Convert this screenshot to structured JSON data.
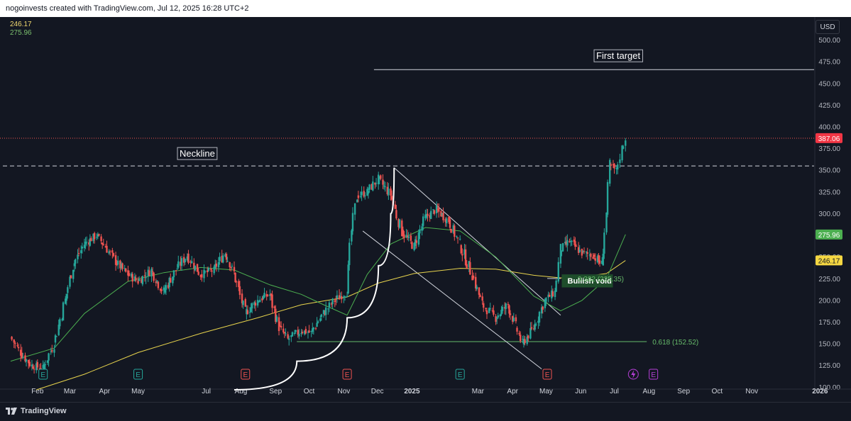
{
  "header": {
    "attribution": "nogoinvests created with TradingView.com, Jul 12, 2025 16:28 UTC+2"
  },
  "legend": {
    "ma_slow_value": "246.17",
    "ma_fast_value": "275.96"
  },
  "currency_button": "USD",
  "footer": {
    "brand": "TradingView"
  },
  "colors": {
    "background": "#131722",
    "up": "#26a69a",
    "down": "#ef5350",
    "ma_fast": "#4caf50",
    "ma_slow": "#e8d44d",
    "last_price": "#ef5350"
  },
  "annotations": {
    "neckline": "Neckline",
    "first_target": "First target",
    "bullish_void": "Bullish void",
    "fib_382": "0.382 (225.35)",
    "fib_618": "0.618 (152.52)"
  },
  "price_tags": {
    "last": "387.06",
    "ma_fast": "275.96",
    "ma_slow": "246.17"
  },
  "earnings_markers": [
    "E",
    "E",
    "E",
    "E",
    "E",
    "E",
    "E"
  ],
  "chart_data": {
    "type": "candlestick",
    "title": "",
    "y_axis": {
      "ticks": [
        100,
        125,
        150,
        175,
        200,
        225,
        250,
        275,
        300,
        325,
        350,
        375,
        400,
        425,
        450,
        475,
        500
      ],
      "range": [
        97,
        516
      ],
      "position": "right"
    },
    "x_axis": {
      "ticks": [
        "Feb",
        "Mar",
        "Apr",
        "May",
        "Jul",
        "Aug",
        "Sep",
        "Oct",
        "Nov",
        "Dec",
        "2025",
        "Mar",
        "Apr",
        "May",
        "Jun",
        "Jul",
        "Aug",
        "Sep",
        "Oct",
        "Nov",
        "2026"
      ],
      "bold": [
        "2025",
        "2026"
      ]
    },
    "closes": [
      {
        "d": "2024-01-08",
        "c": 158
      },
      {
        "d": "2024-01-17",
        "c": 140
      },
      {
        "d": "2024-01-27",
        "c": 125
      },
      {
        "d": "2024-02-06",
        "c": 122
      },
      {
        "d": "2024-02-16",
        "c": 150
      },
      {
        "d": "2024-02-26",
        "c": 200
      },
      {
        "d": "2024-03-04",
        "c": 240
      },
      {
        "d": "2024-03-14",
        "c": 265
      },
      {
        "d": "2024-03-25",
        "c": 275
      },
      {
        "d": "2024-04-02",
        "c": 262
      },
      {
        "d": "2024-04-11",
        "c": 245
      },
      {
        "d": "2024-04-22",
        "c": 230
      },
      {
        "d": "2024-05-01",
        "c": 222
      },
      {
        "d": "2024-05-13",
        "c": 235
      },
      {
        "d": "2024-05-24",
        "c": 210
      },
      {
        "d": "2024-06-04",
        "c": 235
      },
      {
        "d": "2024-06-14",
        "c": 252
      },
      {
        "d": "2024-06-26",
        "c": 230
      },
      {
        "d": "2024-07-08",
        "c": 235
      },
      {
        "d": "2024-07-18",
        "c": 255
      },
      {
        "d": "2024-07-26",
        "c": 232
      },
      {
        "d": "2024-08-05",
        "c": 185
      },
      {
        "d": "2024-08-16",
        "c": 200
      },
      {
        "d": "2024-08-27",
        "c": 207
      },
      {
        "d": "2024-09-04",
        "c": 170
      },
      {
        "d": "2024-09-12",
        "c": 155
      },
      {
        "d": "2024-09-24",
        "c": 165
      },
      {
        "d": "2024-10-03",
        "c": 163
      },
      {
        "d": "2024-10-14",
        "c": 185
      },
      {
        "d": "2024-10-24",
        "c": 200
      },
      {
        "d": "2024-11-04",
        "c": 210
      },
      {
        "d": "2024-11-08",
        "c": 280
      },
      {
        "d": "2024-11-13",
        "c": 320
      },
      {
        "d": "2024-11-22",
        "c": 325
      },
      {
        "d": "2024-12-02",
        "c": 340
      },
      {
        "d": "2024-12-13",
        "c": 322
      },
      {
        "d": "2024-12-23",
        "c": 280
      },
      {
        "d": "2025-01-03",
        "c": 262
      },
      {
        "d": "2025-01-13",
        "c": 295
      },
      {
        "d": "2025-01-23",
        "c": 305
      },
      {
        "d": "2025-02-03",
        "c": 292
      },
      {
        "d": "2025-02-13",
        "c": 265
      },
      {
        "d": "2025-02-24",
        "c": 230
      },
      {
        "d": "2025-03-05",
        "c": 195
      },
      {
        "d": "2025-03-17",
        "c": 180
      },
      {
        "d": "2025-03-28",
        "c": 195
      },
      {
        "d": "2025-04-04",
        "c": 170
      },
      {
        "d": "2025-04-10",
        "c": 150
      },
      {
        "d": "2025-04-20",
        "c": 168
      },
      {
        "d": "2025-04-30",
        "c": 200
      },
      {
        "d": "2025-05-09",
        "c": 210
      },
      {
        "d": "2025-05-14",
        "c": 258
      },
      {
        "d": "2025-05-22",
        "c": 268
      },
      {
        "d": "2025-06-02",
        "c": 255
      },
      {
        "d": "2025-06-12",
        "c": 252
      },
      {
        "d": "2025-06-20",
        "c": 242
      },
      {
        "d": "2025-06-24",
        "c": 300
      },
      {
        "d": "2025-06-27",
        "c": 355
      },
      {
        "d": "2025-07-03",
        "c": 350
      },
      {
        "d": "2025-07-08",
        "c": 375
      },
      {
        "d": "2025-07-11",
        "c": 387
      }
    ],
    "ma_fast_series": [
      {
        "d": "2024-01-08",
        "v": 130
      },
      {
        "d": "2024-02-16",
        "v": 145
      },
      {
        "d": "2024-03-14",
        "v": 185
      },
      {
        "d": "2024-04-22",
        "v": 222
      },
      {
        "d": "2024-05-24",
        "v": 232
      },
      {
        "d": "2024-06-26",
        "v": 238
      },
      {
        "d": "2024-07-26",
        "v": 235
      },
      {
        "d": "2024-08-27",
        "v": 218
      },
      {
        "d": "2024-09-24",
        "v": 207
      },
      {
        "d": "2024-10-14",
        "v": 195
      },
      {
        "d": "2024-11-04",
        "v": 183
      },
      {
        "d": "2024-11-22",
        "v": 230
      },
      {
        "d": "2024-12-13",
        "v": 265
      },
      {
        "d": "2025-01-13",
        "v": 284
      },
      {
        "d": "2025-02-13",
        "v": 280
      },
      {
        "d": "2025-03-17",
        "v": 250
      },
      {
        "d": "2025-04-20",
        "v": 205
      },
      {
        "d": "2025-05-14",
        "v": 188
      },
      {
        "d": "2025-06-02",
        "v": 200
      },
      {
        "d": "2025-06-24",
        "v": 225
      },
      {
        "d": "2025-07-11",
        "v": 276
      }
    ],
    "ma_slow_series": [
      {
        "d": "2024-01-31",
        "v": 97
      },
      {
        "d": "2024-03-14",
        "v": 115
      },
      {
        "d": "2024-05-01",
        "v": 140
      },
      {
        "d": "2024-06-26",
        "v": 162
      },
      {
        "d": "2024-08-16",
        "v": 180
      },
      {
        "d": "2024-09-24",
        "v": 195
      },
      {
        "d": "2024-11-04",
        "v": 204
      },
      {
        "d": "2024-12-02",
        "v": 220
      },
      {
        "d": "2025-01-03",
        "v": 231
      },
      {
        "d": "2025-02-13",
        "v": 237
      },
      {
        "d": "2025-03-17",
        "v": 236
      },
      {
        "d": "2025-04-20",
        "v": 229
      },
      {
        "d": "2025-05-22",
        "v": 225
      },
      {
        "d": "2025-06-24",
        "v": 231
      },
      {
        "d": "2025-07-11",
        "v": 246
      }
    ],
    "levels": {
      "neckline": {
        "v": 355,
        "from": "2024-01-01",
        "to": "2025-09-16"
      },
      "first_target": {
        "v": 466,
        "from": "2024-11-28",
        "to": "2025-09-16"
      },
      "last_price": {
        "v": 387,
        "from": "2024-01-01",
        "to": "2025-09-16"
      },
      "fib_618": {
        "v": 152.52,
        "from": "2024-09-20",
        "to": "2025-07-30"
      },
      "fib_382": {
        "v": 225.35,
        "from": "2025-05-02",
        "to": "2025-05-14"
      }
    },
    "trend_channel": [
      {
        "from": {
          "d": "2024-12-16",
          "v": 353
        },
        "to": {
          "d": "2025-05-14",
          "v": 183
        }
      },
      {
        "from": {
          "d": "2024-11-18",
          "v": 280
        },
        "to": {
          "d": "2025-04-27",
          "v": 121
        }
      }
    ],
    "arc": [
      {
        "d": "2024-07-26",
        "v": 97
      },
      {
        "d": "2024-09-20",
        "v": 130
      },
      {
        "d": "2024-11-04",
        "v": 180
      },
      {
        "d": "2024-12-02",
        "v": 240
      },
      {
        "d": "2024-12-13",
        "v": 300
      },
      {
        "d": "2024-12-16",
        "v": 353
      }
    ],
    "earnings_dates": [
      "2024-02-06",
      "2024-05-01",
      "2024-08-05",
      "2024-11-04",
      "2025-02-13",
      "2025-05-02",
      "2025-08-05"
    ]
  }
}
